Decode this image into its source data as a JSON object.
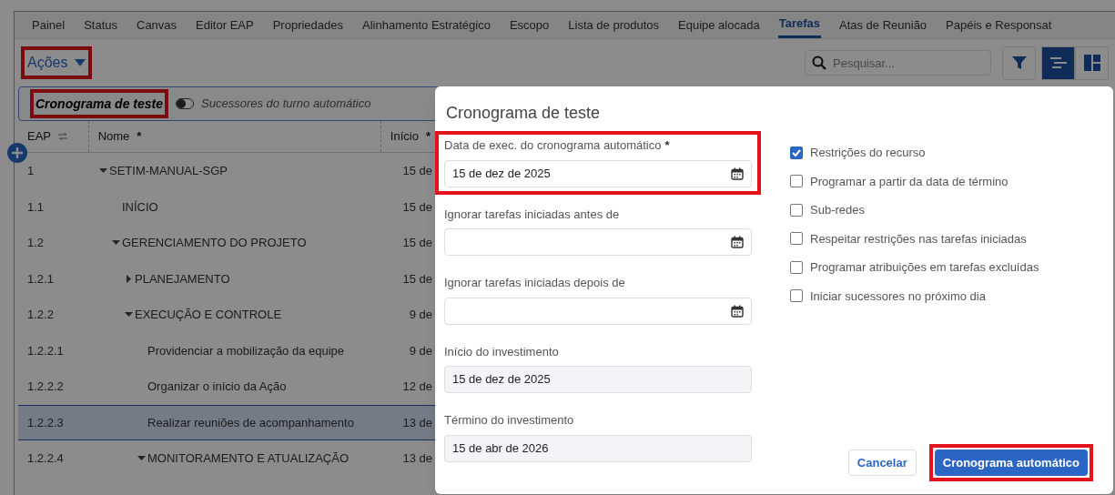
{
  "tabs": [
    {
      "label": "Painel",
      "selected": false
    },
    {
      "label": "Status",
      "selected": false
    },
    {
      "label": "Canvas",
      "selected": false
    },
    {
      "label": "Editor EAP",
      "selected": false
    },
    {
      "label": "Propriedades",
      "selected": false
    },
    {
      "label": "Alinhamento Estratégico",
      "selected": false
    },
    {
      "label": "Escopo",
      "selected": false
    },
    {
      "label": "Lista de produtos",
      "selected": false
    },
    {
      "label": "Equipe alocada",
      "selected": false
    },
    {
      "label": "Tarefas",
      "selected": true
    },
    {
      "label": "Atas de Reunião",
      "selected": false
    },
    {
      "label": "Papéis e Responsat",
      "selected": false
    }
  ],
  "toolbar": {
    "actions": {
      "label": "Ações",
      "highlighted": true
    },
    "search": {
      "placeholder": "Pesquisar..."
    },
    "views": [
      {
        "kind": "filter",
        "selected": false
      },
      {
        "kind": "gantt",
        "selected": true
      },
      {
        "kind": "board",
        "selected": false
      }
    ]
  },
  "schedule_bar": {
    "title": "Cronograma de teste",
    "highlighted": true,
    "toggle": {
      "label": "Sucessores do turno automático",
      "on": false
    }
  },
  "table": {
    "columns": [
      {
        "label": "EAP",
        "kind": "sort"
      },
      {
        "label": "Nome",
        "mark": "*"
      },
      {
        "label": "Início",
        "mark": "*"
      }
    ],
    "rows": [
      {
        "eap": "1",
        "name": "SETIM-MANUAL-SGP",
        "start": "15 de",
        "expanded": true,
        "selected": false,
        "children": [
          {
            "eap": "1.1",
            "name": "INÍCIO",
            "start": "15 de",
            "selected": false
          },
          {
            "eap": "1.2",
            "name": "GERENCIAMENTO DO PROJETO",
            "start": "15 de",
            "expanded": true,
            "selected": false,
            "children": [
              {
                "eap": "1.2.1",
                "name": "PLANEJAMENTO",
                "start": "15 de",
                "expanded": false,
                "selected": false
              },
              {
                "eap": "1.2.2",
                "name": "EXECUÇÃO E CONTROLE",
                "start": "9 de",
                "expanded": true,
                "selected": false,
                "children": [
                  {
                    "eap": "1.2.2.1",
                    "name": "Providenciar a mobilização da equipe",
                    "start": "9 de",
                    "selected": false
                  },
                  {
                    "eap": "1.2.2.2",
                    "name": "Organizar o início da Ação",
                    "start": "12 de",
                    "selected": false
                  },
                  {
                    "eap": "1.2.2.3",
                    "name": "Realizar reuniões de acompanhamento",
                    "start": "13 de",
                    "selected": true
                  },
                  {
                    "eap": "1.2.2.4",
                    "name": "MONITORAMENTO E ATUALIZAÇÃO",
                    "start": "13 de",
                    "expanded": true,
                    "selected": false
                  }
                ]
              }
            ]
          }
        ]
      }
    ]
  },
  "dialog": {
    "title": "Cronograma de teste",
    "fields": [
      {
        "label": "Data de exec. do cronograma automático",
        "mark": "*",
        "value": "15 de dez de 2025",
        "kind": "date",
        "highlighted": true
      },
      {
        "label": "Ignorar tarefas iniciadas antes de",
        "kind": "date",
        "highlighted": false
      },
      {
        "label": "Ignorar tarefas iniciadas depois de",
        "kind": "date",
        "highlighted": false
      },
      {
        "label": "Início do investimento",
        "value": "15 de dez de 2025",
        "kind": "readonly",
        "highlighted": false
      },
      {
        "label": "Término do investimento",
        "value": "15 de abr de 2026",
        "kind": "readonly",
        "highlighted": false
      }
    ],
    "options": [
      {
        "label": "Restrições do recurso",
        "checked": true
      },
      {
        "label": "Programar a partir da data de término",
        "checked": false
      },
      {
        "label": "Sub-redes",
        "checked": false
      },
      {
        "label": "Respeitar restrições nas tarefas iniciadas",
        "checked": false
      },
      {
        "label": "Programar atribuições em tarefas excluídas",
        "checked": false
      },
      {
        "label": "Iniciar sucessores no próximo dia",
        "checked": false
      }
    ],
    "buttons": [
      {
        "label": "Cancelar",
        "kind": "secondary",
        "highlighted": false
      },
      {
        "label": "Cronograma automático",
        "kind": "primary",
        "highlighted": true
      }
    ]
  }
}
